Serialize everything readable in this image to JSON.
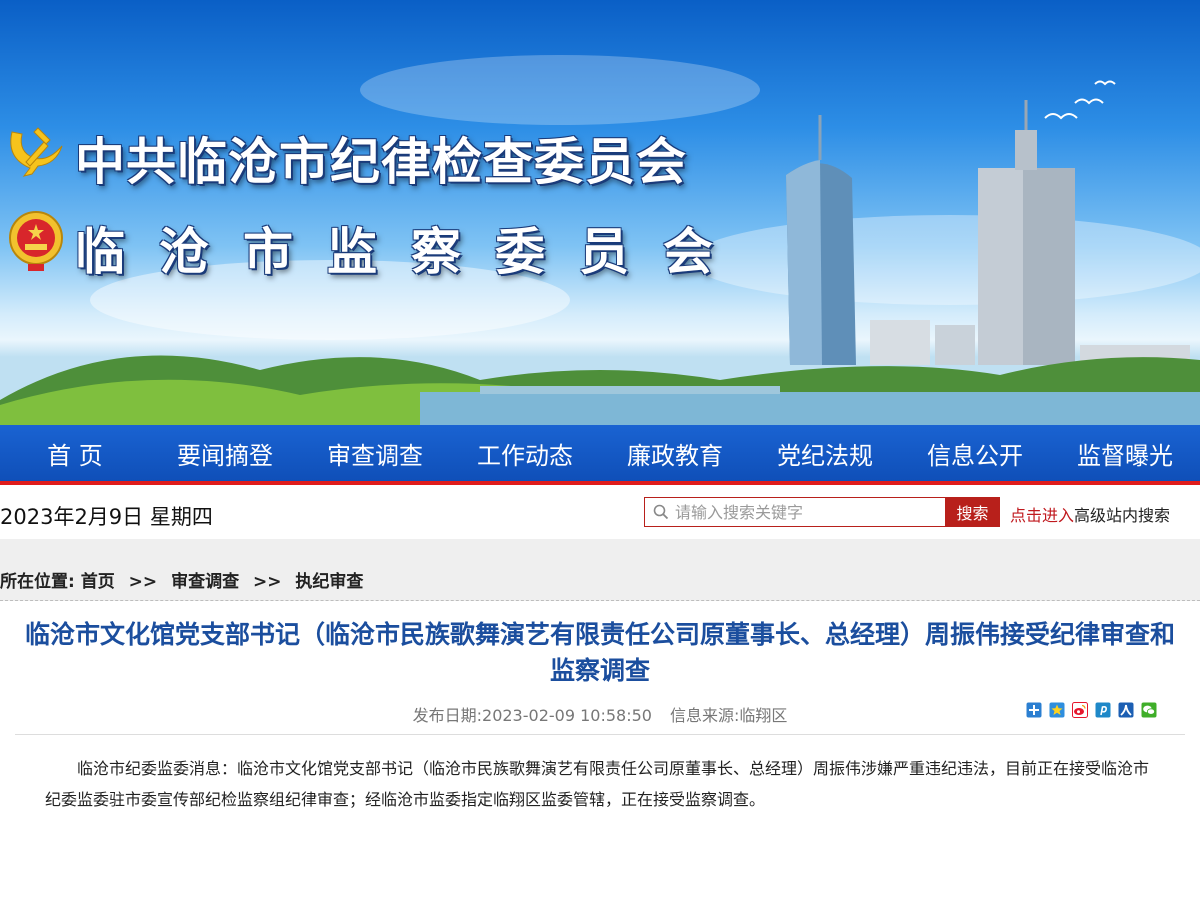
{
  "banner": {
    "title_line1": "中共临沧市纪律检查委员会",
    "title_line2": "临沧市监察委员会"
  },
  "nav": {
    "items": [
      "首 页",
      "要闻摘登",
      "审查调查",
      "工作动态",
      "廉政教育",
      "党纪法规",
      "信息公开",
      "监督曝光"
    ]
  },
  "toolbar": {
    "date": "2023年2月9日 星期四",
    "search_placeholder": "请输入搜索关键字",
    "search_button": "搜索",
    "advanced_link": "点击进入",
    "advanced_text": "高级站内搜索"
  },
  "breadcrumb": {
    "label": "所在位置:",
    "items": [
      "首页",
      "审查调查",
      "执纪审查"
    ],
    "separator": ">>"
  },
  "article": {
    "title": "临沧市文化馆党支部书记（临沧市民族歌舞演艺有限责任公司原董事长、总经理）周振伟接受纪律审查和监察调查",
    "publish_label": "发布日期:",
    "publish_date": "2023-02-09 10:58:50",
    "source_label": "信息来源:",
    "source": "临翔区",
    "body": "临沧市纪委监委消息：临沧市文化馆党支部书记（临沧市民族歌舞演艺有限责任公司原董事长、总经理）周振伟涉嫌严重违纪违法，目前正在接受临沧市纪委监委驻市委宣传部纪检监察组纪律审查；经临沧市监委指定临翔区监委管辖，正在接受监察调查。"
  },
  "share_icons": [
    "plus-share-icon",
    "qzone-icon",
    "weibo-icon",
    "pinterest-icon",
    "renren-icon",
    "wechat-icon"
  ],
  "colors": {
    "nav_blue": "#1a5cc9",
    "nav_border_red": "#e01c1c",
    "search_red": "#b8201b",
    "title_blue": "#1b4e9e",
    "link_red": "#c0191e"
  }
}
